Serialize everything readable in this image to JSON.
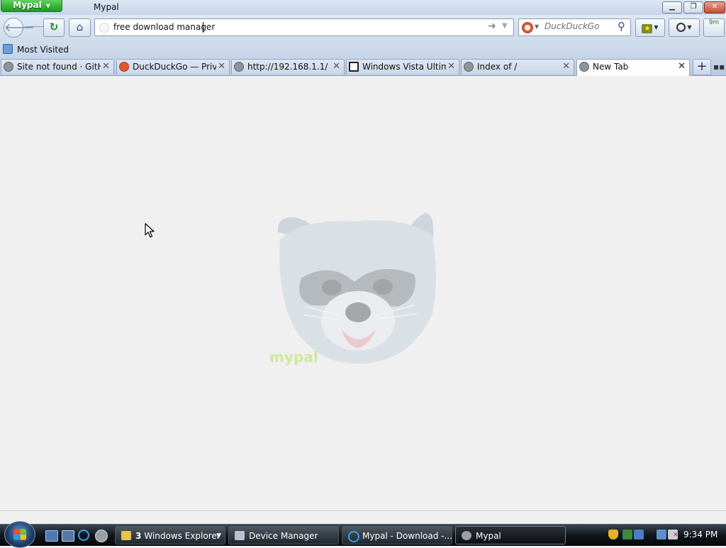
{
  "window": {
    "app_menu_label": "Mypal",
    "title": "Mypal"
  },
  "navbar": {
    "url_value": "free download manager",
    "search_placeholder": "DuckDuckGo",
    "addon_label": "9m"
  },
  "bookmarks_toolbar": {
    "items": [
      {
        "label": "Most Visited"
      }
    ]
  },
  "tabs": [
    {
      "label": "Site not found · GitH...",
      "icon": "globe-icon"
    },
    {
      "label": "DuckDuckGo — Priv...",
      "icon": "duckduckgo-icon"
    },
    {
      "label": "http://192.168.1.1/",
      "icon": "globe-icon"
    },
    {
      "label": "Windows Vista Ultim...",
      "icon": "archive-icon"
    },
    {
      "label": "Index of /",
      "icon": "globe-icon"
    },
    {
      "label": "New Tab",
      "icon": "globe-icon",
      "selected": true
    }
  ],
  "content": {
    "logo_text": "mypal"
  },
  "taskbar": {
    "buttons": [
      {
        "count": "3",
        "label": "Windows Explorer"
      },
      {
        "label": "Device Manager"
      },
      {
        "label": "Mypal - Download -..."
      },
      {
        "label": "Mypal",
        "active": true
      }
    ],
    "clock": "9:34 PM"
  }
}
